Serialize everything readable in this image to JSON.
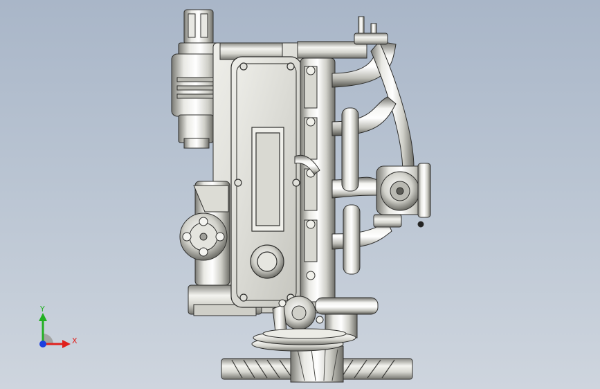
{
  "viewport": {
    "background_top": "#a9b6c8",
    "background_bottom": "#ced5de"
  },
  "model": {
    "name_icon": "engine-3d-model",
    "metal_light": "#f2f2ee",
    "metal_mid": "#c9c9c2",
    "metal_dark": "#6b6b66",
    "outline": "#2e2e2c"
  },
  "triad": {
    "x_label": "X",
    "y_label": "Y",
    "x_color": "#e0201c",
    "y_color": "#22b022",
    "z_color": "#1c3fe0"
  }
}
